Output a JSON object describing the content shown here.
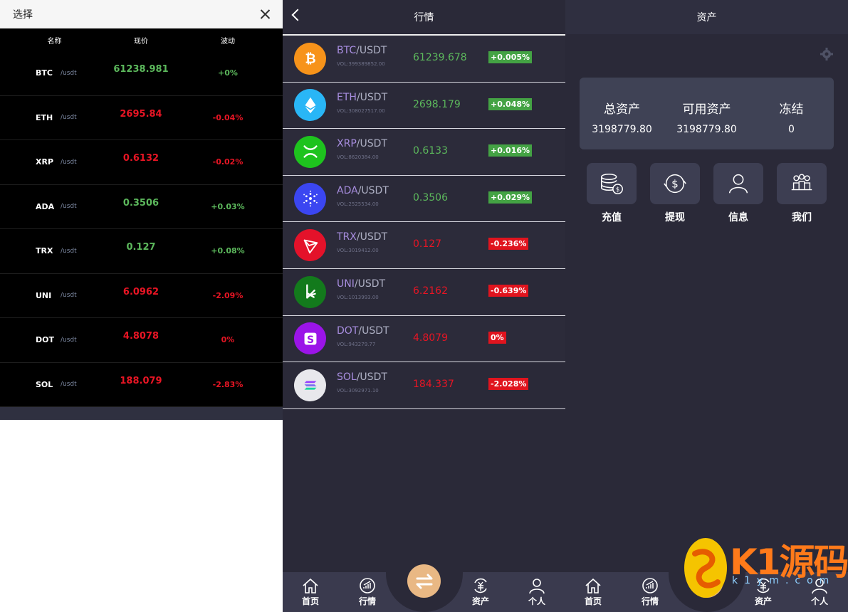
{
  "select_popup": {
    "title": "选择",
    "columns": [
      "名称",
      "现价",
      "波动"
    ],
    "rows": [
      {
        "sym": "BTC",
        "pair": "/usdt",
        "price": "61238.981",
        "change": "+0%",
        "trend": "up"
      },
      {
        "sym": "ETH",
        "pair": "/usdt",
        "price": "2695.84",
        "change": "-0.04%",
        "trend": "down"
      },
      {
        "sym": "XRP",
        "pair": "/usdt",
        "price": "0.6132",
        "change": "-0.02%",
        "trend": "down"
      },
      {
        "sym": "ADA",
        "pair": "/usdt",
        "price": "0.3506",
        "change": "+0.03%",
        "trend": "up"
      },
      {
        "sym": "TRX",
        "pair": "/usdt",
        "price": "0.127",
        "change": "+0.08%",
        "trend": "up"
      },
      {
        "sym": "UNI",
        "pair": "/usdt",
        "price": "6.0962",
        "change": "-2.09%",
        "trend": "down"
      },
      {
        "sym": "DOT",
        "pair": "/usdt",
        "price": "4.8078",
        "change": "0%",
        "trend": "down"
      },
      {
        "sym": "SOL",
        "pair": "/usdt",
        "price": "188.079",
        "change": "-2.83%",
        "trend": "down"
      }
    ]
  },
  "market": {
    "title": "行情",
    "rows": [
      {
        "sym": "BTC",
        "quote": "/USDT",
        "vol": "VOL:399389852.00",
        "price": "61239.678",
        "change": "+0.005%",
        "trend": "up",
        "icon": "bitcoin-icon",
        "color": "#f7931a"
      },
      {
        "sym": "ETH",
        "quote": "/USDT",
        "vol": "VOL:308027517.00",
        "price": "2698.179",
        "change": "+0.048%",
        "trend": "up",
        "icon": "ethereum-icon",
        "color": "#29b6f6"
      },
      {
        "sym": "XRP",
        "quote": "/USDT",
        "vol": "VOL:8620384.00",
        "price": "0.6133",
        "change": "+0.016%",
        "trend": "up",
        "icon": "xrp-icon",
        "color": "#1ec31e"
      },
      {
        "sym": "ADA",
        "quote": "/USDT",
        "vol": "VOL:2525534.00",
        "price": "0.3506",
        "change": "+0.029%",
        "trend": "up",
        "icon": "cardano-icon",
        "color": "#3b46f1"
      },
      {
        "sym": "TRX",
        "quote": "/USDT",
        "vol": "VOL:3019412.00",
        "price": "0.127",
        "change": "-0.236%",
        "trend": "down",
        "icon": "tron-icon",
        "color": "#e4122a"
      },
      {
        "sym": "UNI",
        "quote": "/USDT",
        "vol": "VOL:1013993.00",
        "price": "6.2162",
        "change": "-0.639%",
        "trend": "down",
        "icon": "uni-icon",
        "color": "#137a1c"
      },
      {
        "sym": "DOT",
        "quote": "/USDT",
        "vol": "VOL:943279.77",
        "price": "4.8079",
        "change": "0%",
        "trend": "down",
        "icon": "dot-icon",
        "color": "#9b14e8"
      },
      {
        "sym": "SOL",
        "quote": "/USDT",
        "vol": "VOL:3092971.10",
        "price": "184.337",
        "change": "-2.028%",
        "trend": "down",
        "icon": "solana-icon",
        "color": "#e8e8ec"
      }
    ]
  },
  "tabbar": {
    "home": "首页",
    "market": "行情",
    "assets": "资产",
    "profile": "个人"
  },
  "assets": {
    "title": "资产",
    "summary": [
      {
        "label": "总资产",
        "value": "3198779.80"
      },
      {
        "label": "可用资产",
        "value": "3198779.80"
      },
      {
        "label": "冻结",
        "value": "0"
      }
    ],
    "actions": [
      "充值",
      "提现",
      "信息",
      "我们"
    ]
  },
  "watermark": {
    "brand": "K1源码",
    "site": "k1ym.com"
  },
  "colors": {
    "up": "#5cb85c",
    "down": "#e81524",
    "accent": "#e9b884",
    "bg": "#2a2938"
  }
}
